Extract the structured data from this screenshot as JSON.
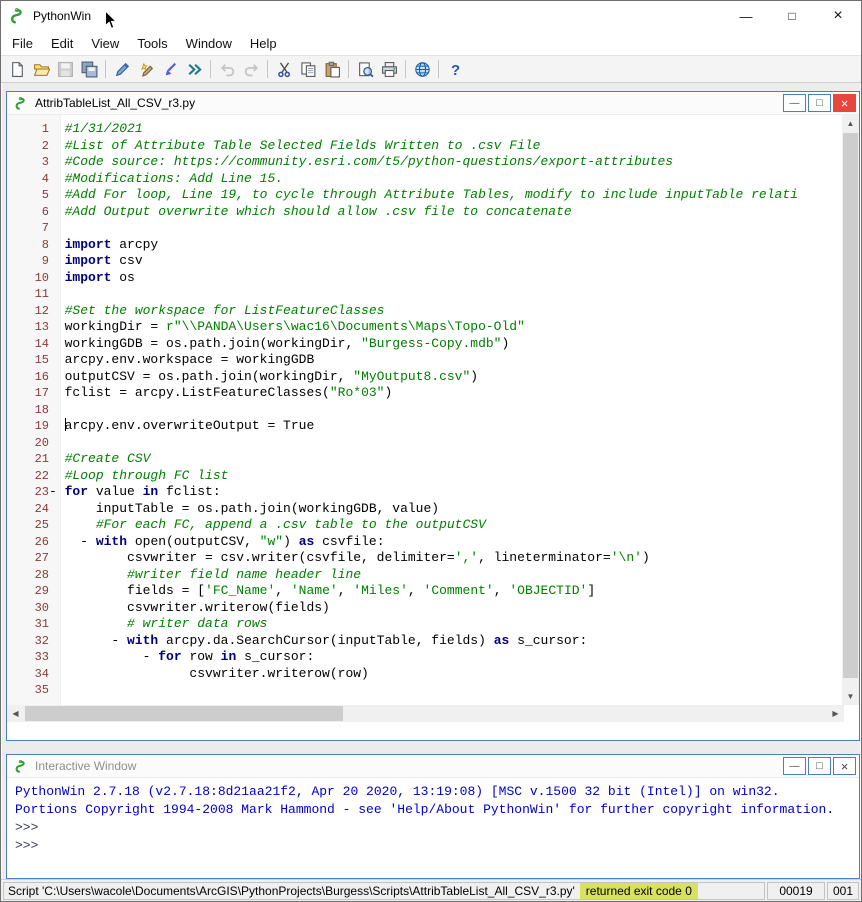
{
  "window": {
    "title": "PythonWin",
    "controls": {
      "minimize": "—",
      "maximize": "□",
      "close": "×"
    }
  },
  "child_controls": {
    "minimize": "—",
    "maximize": "□",
    "close": "×"
  },
  "scrollbar": {
    "up": "▲",
    "down": "▼",
    "left": "◀",
    "right": "▶"
  },
  "menu": {
    "items": [
      "File",
      "Edit",
      "View",
      "Tools",
      "Window",
      "Help"
    ]
  },
  "toolbar": {
    "items": [
      {
        "name": "new-file-icon"
      },
      {
        "name": "open-file-icon"
      },
      {
        "name": "save-icon",
        "disabled": true
      },
      {
        "name": "save-all-icon"
      },
      {
        "sep": true
      },
      {
        "name": "edit-pencil-icon"
      },
      {
        "name": "macro-edit-icon"
      },
      {
        "name": "import-script-icon"
      },
      {
        "name": "run-script-icon"
      },
      {
        "sep": true
      },
      {
        "name": "undo-icon",
        "disabled": true
      },
      {
        "name": "redo-icon",
        "disabled": true
      },
      {
        "sep": true
      },
      {
        "name": "cut-icon"
      },
      {
        "name": "copy-icon"
      },
      {
        "name": "paste-icon"
      },
      {
        "sep": true
      },
      {
        "name": "print-preview-icon"
      },
      {
        "name": "print-icon"
      },
      {
        "sep": true
      },
      {
        "name": "web-help-icon"
      },
      {
        "sep": true
      },
      {
        "name": "help-icon"
      }
    ]
  },
  "editor": {
    "title": "AttribTableList_All_CSV_r3.py",
    "lines": [
      {
        "n": 1,
        "segs": [
          [
            "#1/31/2021",
            "c"
          ]
        ]
      },
      {
        "n": 2,
        "segs": [
          [
            "#List of Attribute Table Selected Fields Written to .csv File",
            "c"
          ]
        ]
      },
      {
        "n": 3,
        "segs": [
          [
            "#Code source: https://community.esri.com/t5/python-questions/export-attributes",
            "c"
          ]
        ]
      },
      {
        "n": 4,
        "segs": [
          [
            "#Modifications: Add Line 15.",
            "c"
          ]
        ]
      },
      {
        "n": 5,
        "segs": [
          [
            "#Add For loop, Line 19, to cycle through Attribute Tables, modify to include inputTable relati",
            "c"
          ]
        ]
      },
      {
        "n": 6,
        "segs": [
          [
            "#Add Output overwrite which should allow .csv file to concatenate",
            "c"
          ]
        ]
      },
      {
        "n": 7,
        "segs": []
      },
      {
        "n": 8,
        "segs": [
          [
            "import",
            "k"
          ],
          [
            " arcpy",
            "p"
          ]
        ]
      },
      {
        "n": 9,
        "segs": [
          [
            "import",
            "k"
          ],
          [
            " csv",
            "p"
          ]
        ]
      },
      {
        "n": 10,
        "segs": [
          [
            "import",
            "k"
          ],
          [
            " os",
            "p"
          ]
        ]
      },
      {
        "n": 11,
        "segs": []
      },
      {
        "n": 12,
        "segs": [
          [
            "#Set the workspace for ListFeatureClasses",
            "c"
          ]
        ]
      },
      {
        "n": 13,
        "segs": [
          [
            "workingDir = ",
            "p"
          ],
          [
            "r\"\\\\PANDA\\Users\\wac16\\Documents\\Maps\\Topo-Old\"",
            "s"
          ]
        ]
      },
      {
        "n": 14,
        "segs": [
          [
            "workingGDB = os.path.join(workingDir, ",
            "p"
          ],
          [
            "\"Burgess-Copy.mdb\"",
            "s"
          ],
          [
            ")",
            "p"
          ]
        ]
      },
      {
        "n": 15,
        "segs": [
          [
            "arcpy.env.workspace = workingGDB",
            "p"
          ]
        ]
      },
      {
        "n": 16,
        "segs": [
          [
            "outputCSV = os.path.join(workingDir, ",
            "p"
          ],
          [
            "\"MyOutput8.csv\"",
            "s"
          ],
          [
            ")",
            "p"
          ]
        ]
      },
      {
        "n": 17,
        "segs": [
          [
            "fclist = arcpy.ListFeatureClasses(",
            "p"
          ],
          [
            "\"Ro*03\"",
            "s"
          ],
          [
            ")",
            "p"
          ]
        ]
      },
      {
        "n": 18,
        "segs": []
      },
      {
        "n": 19,
        "caret": true,
        "segs": [
          [
            "arcpy.env.overwriteOutput = True",
            "p"
          ]
        ]
      },
      {
        "n": 20,
        "segs": []
      },
      {
        "n": 21,
        "segs": [
          [
            "#Create CSV",
            "c"
          ]
        ]
      },
      {
        "n": 22,
        "segs": [
          [
            "#Loop through FC list",
            "c"
          ]
        ]
      },
      {
        "n": 23,
        "fold": true,
        "segs": [
          [
            "for",
            "k"
          ],
          [
            " value ",
            "p"
          ],
          [
            "in",
            "k"
          ],
          [
            " fclist:",
            "p"
          ]
        ]
      },
      {
        "n": 24,
        "segs": [
          [
            "    inputTable = os.path.join(workingGDB, value)",
            "p"
          ]
        ]
      },
      {
        "n": 25,
        "segs": [
          [
            "    ",
            "p"
          ],
          [
            "#For each FC, append a .csv table to the outputCSV",
            "c"
          ]
        ]
      },
      {
        "n": 26,
        "segs": [
          [
            "  - ",
            "f"
          ],
          [
            "with",
            "k"
          ],
          [
            " open(outputCSV, ",
            "p"
          ],
          [
            "\"w\"",
            "s"
          ],
          [
            ") ",
            "p"
          ],
          [
            "as",
            "k"
          ],
          [
            " csvfile:",
            "p"
          ]
        ]
      },
      {
        "n": 27,
        "segs": [
          [
            "        csvwriter = csv.writer(csvfile, delimiter=",
            "p"
          ],
          [
            "','",
            "s"
          ],
          [
            ", lineterminator=",
            "p"
          ],
          [
            "'\\n'",
            "s"
          ],
          [
            ")",
            "p"
          ]
        ]
      },
      {
        "n": 28,
        "segs": [
          [
            "        ",
            "p"
          ],
          [
            "#writer field name header line",
            "c"
          ]
        ]
      },
      {
        "n": 29,
        "segs": [
          [
            "        fields = [",
            "p"
          ],
          [
            "'FC_Name'",
            "s"
          ],
          [
            ", ",
            "p"
          ],
          [
            "'Name'",
            "s"
          ],
          [
            ", ",
            "p"
          ],
          [
            "'Miles'",
            "s"
          ],
          [
            ", ",
            "p"
          ],
          [
            "'Comment'",
            "s"
          ],
          [
            ", ",
            "p"
          ],
          [
            "'OBJECTID'",
            "s"
          ],
          [
            "]",
            "p"
          ]
        ]
      },
      {
        "n": 30,
        "segs": [
          [
            "        csvwriter.writerow(fields)",
            "p"
          ]
        ]
      },
      {
        "n": 31,
        "segs": [
          [
            "        ",
            "p"
          ],
          [
            "# writer data rows",
            "c"
          ]
        ]
      },
      {
        "n": 32,
        "segs": [
          [
            "      - ",
            "f"
          ],
          [
            "with",
            "k"
          ],
          [
            " arcpy.da.SearchCursor(inputTable, fields) ",
            "p"
          ],
          [
            "as",
            "k"
          ],
          [
            " s_cursor:",
            "p"
          ]
        ]
      },
      {
        "n": 33,
        "segs": [
          [
            "          - ",
            "f"
          ],
          [
            "for",
            "k"
          ],
          [
            " row ",
            "p"
          ],
          [
            "in",
            "k"
          ],
          [
            " s_cursor:",
            "p"
          ]
        ]
      },
      {
        "n": 34,
        "segs": [
          [
            "                csvwriter.writerow(row)",
            "p"
          ]
        ]
      },
      {
        "n": 35,
        "segs": []
      }
    ]
  },
  "interactive": {
    "title": "Interactive Window",
    "lines": [
      {
        "text": "PythonWin 2.7.18 (v2.7.18:8d21aa21f2, Apr 20 2020, 13:19:08) [MSC v.1500 32 bit (Intel)] on win32.",
        "cls": "banner"
      },
      {
        "text": "Portions Copyright 1994-2008 Mark Hammond - see 'Help/About PythonWin' for further copyright information.",
        "cls": "banner"
      },
      {
        "text": ">>> ",
        "cls": "prompt"
      },
      {
        "text": ">>> ",
        "cls": "prompt"
      }
    ]
  },
  "statusbar": {
    "script_text": "Script 'C:\\Users\\wacole\\Documents\\ArcGIS\\PythonProjects\\Burgess\\Scripts\\AttribTableList_All_CSV_r3.py'",
    "exit_text": "returned exit code 0",
    "field1": "00019",
    "field2": "001"
  },
  "colors": {
    "child_border": "#4a7fc1",
    "close_red": "#e8463c",
    "keyword": "#00007f",
    "comment": "#007f00",
    "string": "#007f00",
    "linenum": "#8b3a3a",
    "banner": "#0000cc",
    "prompt": "#3a3a5c",
    "status_highlight": "#d9e25f"
  }
}
